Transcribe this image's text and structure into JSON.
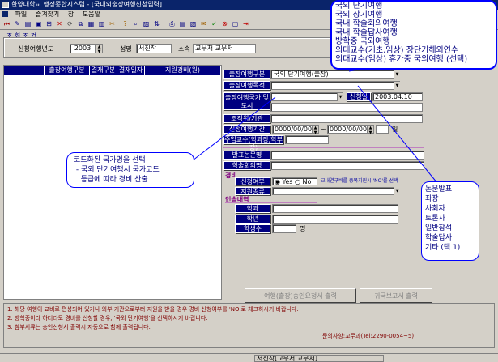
{
  "window": {
    "title": "한양대학교 행정종합시스템 - [국내외출장여행신청입력]"
  },
  "menu": [
    "파일",
    "즐겨찾기",
    "창",
    "도움말"
  ],
  "conditions": {
    "section_label": "조 회 조 건",
    "year_label": "신청여행년도",
    "year_value": "2003",
    "name_label": "성명",
    "name_value": "서진작",
    "dept_label": "소속",
    "dept_value": "교무처 교무처"
  },
  "grid": {
    "columns": [
      "출장여행구분",
      "결재구분",
      "결재일자",
      "지원경비(원)"
    ]
  },
  "form": {
    "trip_type_label": "출장여행구분",
    "trip_type_value": "국외 단기여행(출장)",
    "purpose_label": "출장여행목적",
    "country_label": "출장여행국가 및 도시",
    "request_date_label": "신청일",
    "request_date_value": "2003.04.10",
    "org_label": "조직위/기관",
    "period_label": "신청여행기간",
    "date_from": "0000/00/00",
    "date_to": "0000/00/00",
    "period_sep": "~",
    "days_unit": "일",
    "accompany_label": "주임교수(학과장,학부장)",
    "paper_title_label": "발표논문명",
    "conference_label": "학술회의명",
    "expense_section": "경비",
    "apply_label": "신청여부",
    "yes_label": "Yes",
    "no_label": "No",
    "apply_note": "교내연구비를 중복지원시 'NO'를 선택",
    "support_label": "지원종류",
    "accompany_section": "인솔내역",
    "dept_field_label": "학과",
    "grade_label": "학년",
    "student_count_label": "학생수",
    "student_unit": "명",
    "print_button_1": "여행(출장)승인요청서 출력",
    "print_button_2": "귀국보고서 출력"
  },
  "notes": [
    "1. 해당 여행이 교비로 편성되어 있거나 외부 기관으로부터 지원을 받을 경우 경비 신청여부를 'NO'로 체크하시기 바랍니다.",
    "2. 방학중이라 하더라도 경비를 신청할 경우, '국외 단기여행'을 선택하시기 바랍니다.",
    "3. 참부서류는 승인신청서 출력시 자동으로 함께 출력됩니다."
  ],
  "contact": "문의사항:교무과(Tel:2290-0054~5)",
  "status_user": "서진작[교무처 교무처]",
  "trip_options": [
    "국외 단기여행",
    "국외 장기여행",
    "국내 학술회의여행",
    "국내 학술답사여행",
    "방학중 국외여행",
    "의대교수(기초,임상) 장단기해외연수",
    "의대교수(임상) 휴가중 국외여행 (선택)"
  ],
  "callout_country": [
    "코드화된 국가명을 선택",
    " - 국외 단기여행시 국가코드",
    "   등급에 따라 경비 산출"
  ],
  "purpose_options": [
    "논문발표",
    "좌장",
    "사회자",
    "토론자",
    "일반참석",
    "학술답사",
    "기타 (택 1)"
  ]
}
